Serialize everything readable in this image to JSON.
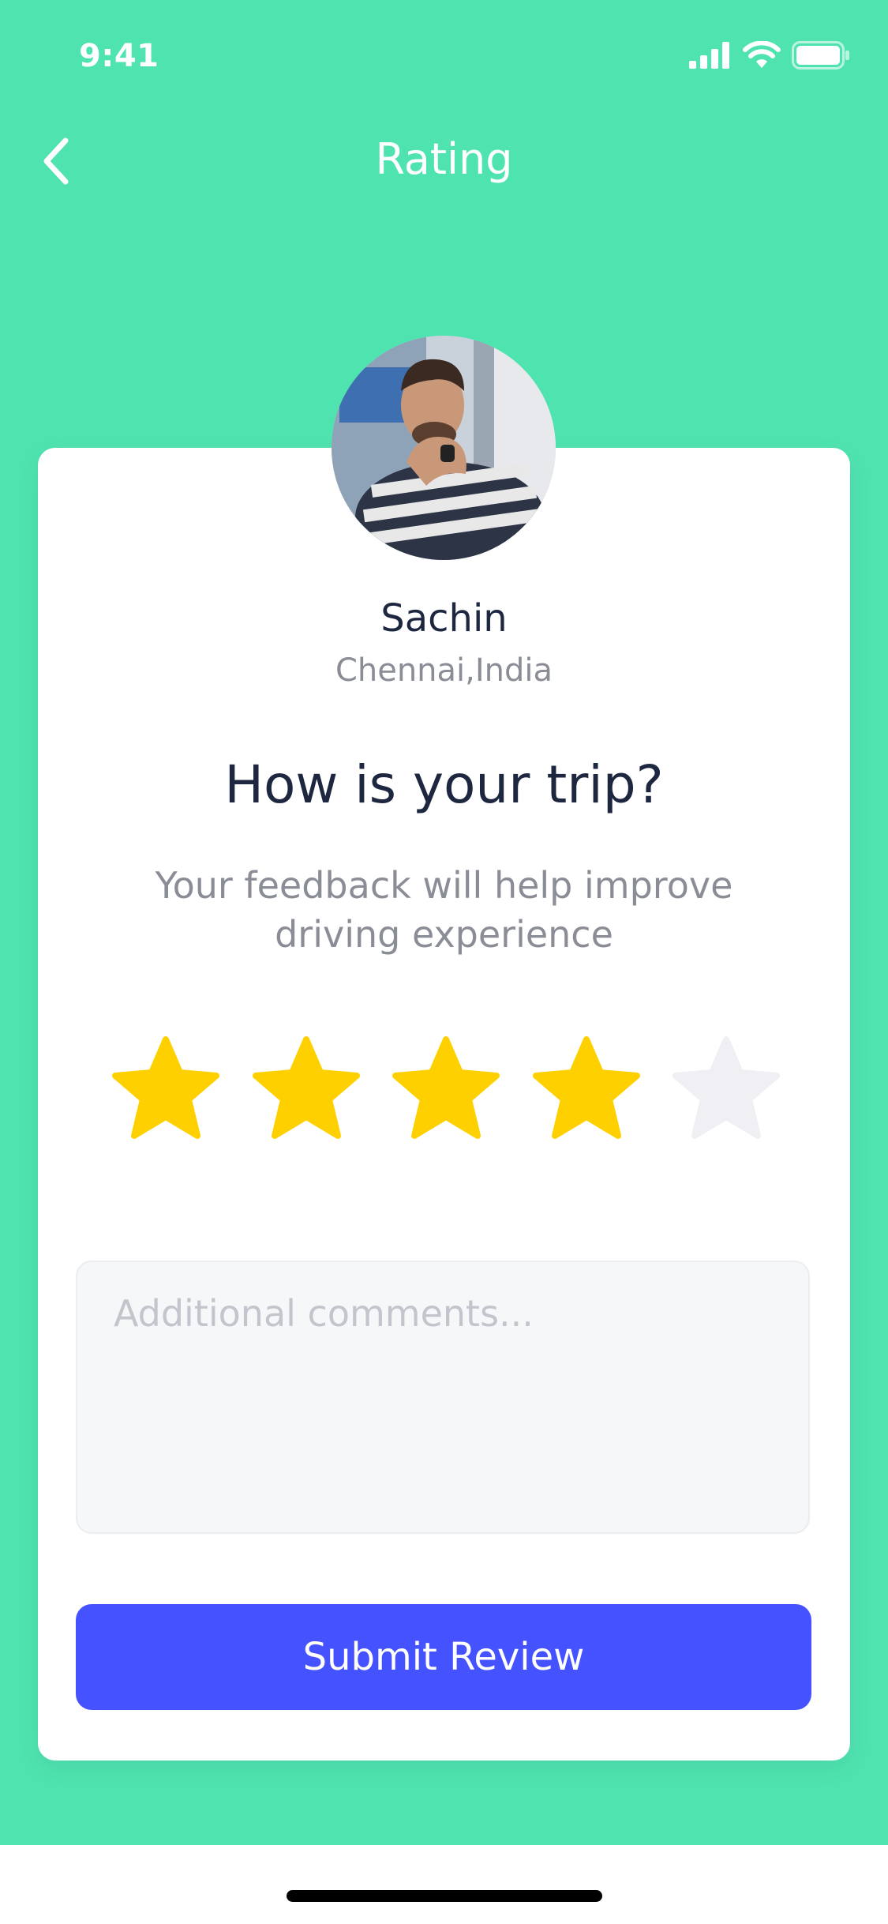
{
  "status_bar": {
    "time": "9:41"
  },
  "nav": {
    "title": "Rating"
  },
  "driver": {
    "name": "Sachin",
    "location": "Chennai,India"
  },
  "rating": {
    "question": "How is your trip?",
    "hint": "Your feedback will help improve driving experience",
    "value": 4,
    "max": 5,
    "filled_color": "#FFD000",
    "empty_color": "#EFEFF4"
  },
  "comments": {
    "placeholder": "Additional comments...",
    "value": ""
  },
  "submit": {
    "label": "Submit Review"
  },
  "colors": {
    "background": "#4FE3B0",
    "accent": "#4552FF",
    "card": "#FFFFFF"
  },
  "icons": {
    "back": "chevron-left-icon",
    "signal": "cellular-signal-icon",
    "wifi": "wifi-icon",
    "battery": "battery-icon",
    "star": "star-icon"
  }
}
